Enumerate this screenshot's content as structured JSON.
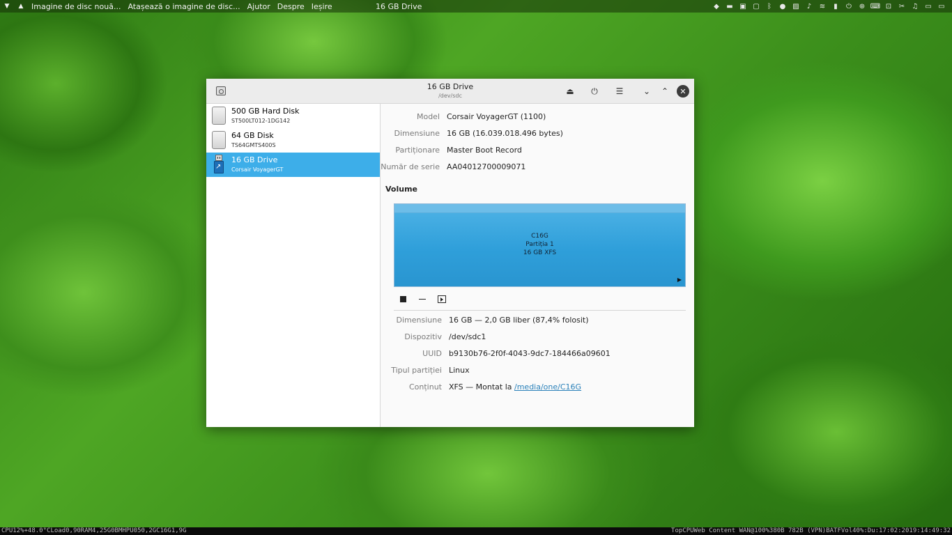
{
  "top_panel": {
    "menu_items": [
      "Imagine de disc nouă...",
      "Atașează o imagine de disc...",
      "Ajutor",
      "Despre",
      "Ieșire"
    ],
    "window_title": "16 GB Drive"
  },
  "window": {
    "title": "16 GB Drive",
    "subtitle": "/dev/sdc"
  },
  "drives": [
    {
      "name": "500 GB Hard Disk",
      "detail": "ST500LT012-1DG142",
      "icon": "hard-disk-icon"
    },
    {
      "name": "64 GB Disk",
      "detail": "TS64GMTS400S",
      "icon": "disk-icon"
    },
    {
      "name": "16 GB Drive",
      "detail": "Corsair VoyagerGT",
      "icon": "usb-drive-icon",
      "selected": true
    }
  ],
  "drive_props": {
    "model_label": "Model",
    "model_value": "Corsair VoyagerGT (1100)",
    "size_label": "Dimensiune",
    "size_value": "16 GB (16.039.018.496 bytes)",
    "partitioning_label": "Partiționare",
    "partitioning_value": "Master Boot Record",
    "serial_label": "Număr de serie",
    "serial_value": "AA04012700009071"
  },
  "volumes": {
    "title": "Volume",
    "partition_name": "C16G",
    "partition_index": "Partiția 1",
    "partition_fs": "16 GB XFS"
  },
  "volume_props": {
    "size_label": "Dimensiune",
    "size_value": "16 GB — 2,0 GB liber (87,4% folosit)",
    "device_label": "Dispozitiv",
    "device_value": "/dev/sdc1",
    "uuid_label": "UUID",
    "uuid_value": "b9130b76-2f0f-4043-9dc7-184466a09601",
    "type_label": "Tipul partiției",
    "type_value": "Linux",
    "contents_label": "Conținut",
    "contents_prefix": "XFS — Montat la",
    "contents_link": "/media/one/C16G"
  },
  "bottom_panel": {
    "left": "CPU12%+48.0°CLoad0,90RAM4,25G0BMHPU050,2GC16G1,9G",
    "right": "TopCPUWeb Content    WAN@100%380B  782B  (VPN)BATFVol40%:Du:17:02:2019:14:49:32"
  }
}
